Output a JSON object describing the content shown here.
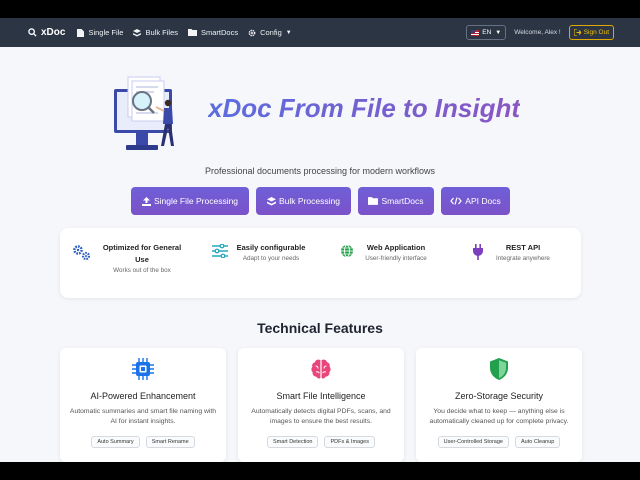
{
  "navbar": {
    "brand": "xDoc",
    "links": [
      {
        "label": "Single File",
        "icon": "file-icon"
      },
      {
        "label": "Bulk Files",
        "icon": "layers-icon"
      },
      {
        "label": "SmartDocs",
        "icon": "folder-icon"
      },
      {
        "label": "Config",
        "icon": "gear-icon"
      }
    ],
    "language": "EN",
    "welcome": "Welcome, Alex !",
    "sign_out": "Sign Out"
  },
  "hero": {
    "title": "xDoc From File to Insight",
    "subtitle": "Professional documents processing for modern workflows",
    "buttons": [
      {
        "label": "Single File Processing",
        "icon": "upload-icon"
      },
      {
        "label": "Bulk Processing",
        "icon": "layers-icon"
      },
      {
        "label": "SmartDocs",
        "icon": "folder-icon"
      },
      {
        "label": "API Docs",
        "icon": "code-icon"
      }
    ]
  },
  "features": [
    {
      "title": "Optimized for General Use",
      "desc": "Works out of the box",
      "icon": "gears-icon"
    },
    {
      "title": "Easily configurable",
      "desc": "Adapt to your needs",
      "icon": "sliders-icon"
    },
    {
      "title": "Web Application",
      "desc": "User-friendly interface",
      "icon": "globe-icon"
    },
    {
      "title": "REST API",
      "desc": "Integrate anywhere",
      "icon": "plug-icon"
    }
  ],
  "technical": {
    "title": "Technical Features",
    "cards": [
      {
        "title": "AI-Powered Enhancement",
        "desc": "Automatic summaries and smart file naming with AI for instant insights.",
        "tags": [
          "Auto Summary",
          "Smart Rename"
        ],
        "icon": "chip-icon"
      },
      {
        "title": "Smart File Intelligence",
        "desc": "Automatically detects digital PDFs, scans, and images to ensure the best results.",
        "tags": [
          "Smart Detection",
          "PDFs & Images"
        ],
        "icon": "brain-icon"
      },
      {
        "title": "Zero-Storage Security",
        "desc": "You decide what to keep — anything else is automatically cleaned up for complete privacy.",
        "tags": [
          "User-Controlled Storage",
          "Auto Cleanup"
        ],
        "icon": "shield-icon"
      }
    ]
  },
  "colors": {
    "navbar": "#2b3544",
    "accent": "#6f5fd8",
    "signout": "#f0c000",
    "chip": "#1a73e8",
    "brain": "#e8457a",
    "shield": "#22a04b"
  }
}
